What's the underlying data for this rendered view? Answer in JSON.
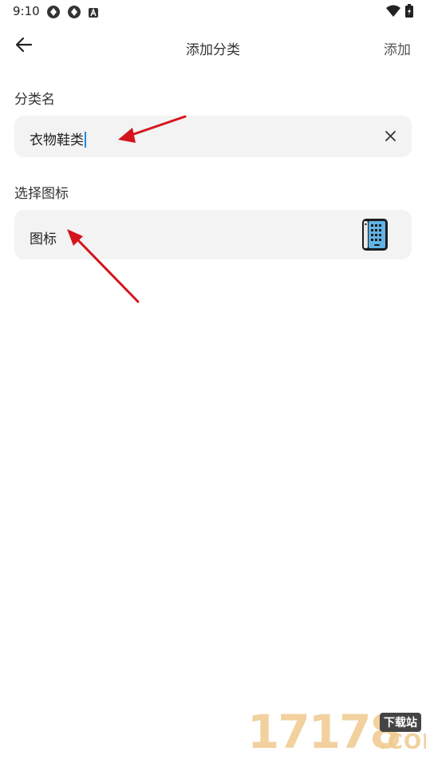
{
  "status_bar": {
    "time": "9:10",
    "left_icons": [
      "network-icon",
      "network-icon",
      "a-icon"
    ],
    "right_icons": [
      "wifi-icon",
      "battery-icon"
    ]
  },
  "app_bar": {
    "back_icon": "arrow-left-icon",
    "title": "添加分类",
    "action_label": "添加"
  },
  "form": {
    "name_label": "分类名",
    "name_value": "衣物鞋类",
    "clear_icon": "close-icon",
    "icon_section_label": "选择图标",
    "icon_field_label": "图标",
    "selected_icon": "phone-icon"
  },
  "watermark": {
    "digits": "17178",
    "tag": "下载站",
    "domain": ".COM"
  },
  "colors": {
    "field_bg": "#f3f3f3",
    "caret": "#1e88e5",
    "annotation_arrow": "#d4141c"
  }
}
